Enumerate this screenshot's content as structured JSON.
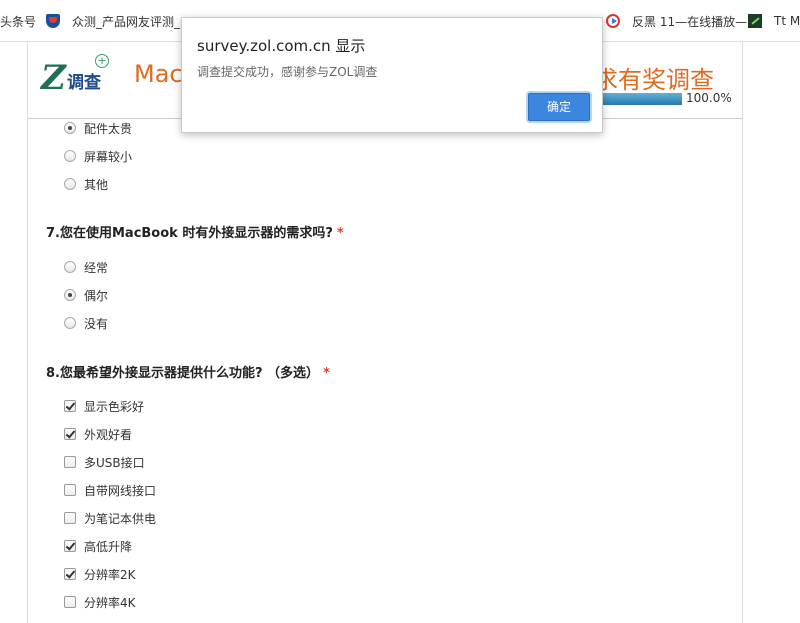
{
  "bookmarks": [
    {
      "label": "头条号",
      "icon": "none"
    },
    {
      "label": "众测_产品网友评测_",
      "icon": "shield-icon"
    },
    {
      "label": "反黑 11—在线播放—",
      "icon": "play-circle-icon"
    },
    {
      "label": "Tt MC",
      "icon": "zed-icon"
    }
  ],
  "header": {
    "logo_letter": "Z",
    "logo_text": "调查",
    "logo_plus": "+",
    "title_left": "Mac",
    "title_right": "求有奖调查",
    "progress_percent": 100,
    "progress_label": "100.0%"
  },
  "q6_options": [
    {
      "label": "配件太贵",
      "selected": true
    },
    {
      "label": "屏幕较小",
      "selected": false
    },
    {
      "label": "其他",
      "selected": false
    }
  ],
  "q7": {
    "title": "7.您在使用MacBook 时有外接显示器的需求吗?",
    "required_mark": "*",
    "options": [
      {
        "label": "经常",
        "selected": false
      },
      {
        "label": "偶尔",
        "selected": true
      },
      {
        "label": "没有",
        "selected": false
      }
    ]
  },
  "q8": {
    "title": "8.您最希望外接显示器提供什么功能? （多选）",
    "required_mark": "*",
    "options": [
      {
        "label": "显示色彩好",
        "checked": true
      },
      {
        "label": "外观好看",
        "checked": true
      },
      {
        "label": "多USB接口",
        "checked": false
      },
      {
        "label": "自带网线接口",
        "checked": false
      },
      {
        "label": "为笔记本供电",
        "checked": false
      },
      {
        "label": "高低升降",
        "checked": true
      },
      {
        "label": "分辨率2K",
        "checked": true
      },
      {
        "label": "分辨率4K",
        "checked": false
      }
    ]
  },
  "dialog": {
    "title": "survey.zol.com.cn 显示",
    "message": "调查提交成功，感谢参与ZOL调查",
    "ok_label": "确定"
  },
  "colors": {
    "accent_orange": "#e06b1f",
    "button_blue": "#3b87e0",
    "required_red": "#e04030"
  }
}
